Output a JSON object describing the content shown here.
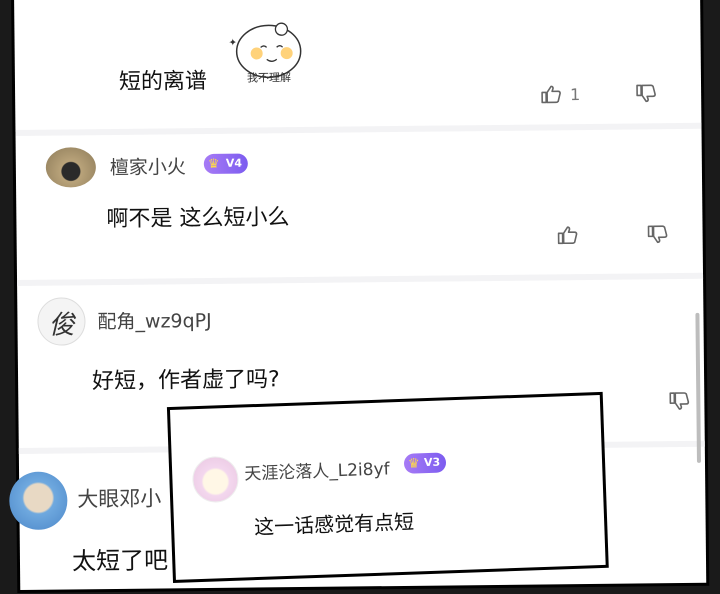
{
  "comments": [
    {
      "content": "短的离谱",
      "like_count": "1",
      "sticker_text": "我不理解"
    },
    {
      "username": "檀家小火",
      "badge": "V4",
      "content": "啊不是 这么短小么"
    },
    {
      "username": "配角_wz9qPJ",
      "avatar_text": "俊",
      "content": "好短，作者虚了吗?"
    },
    {
      "username": "大眼邓小",
      "content": "太短了吧"
    }
  ],
  "overlay_comment": {
    "username": "天涯沦落人_L2i8yf",
    "badge": "V3",
    "content": "这一话感觉有点短"
  },
  "icons": {
    "like": "thumbs-up-icon",
    "dislike": "thumbs-down-icon"
  },
  "colors": {
    "badge": "#8b65f2",
    "text": "#111111",
    "muted": "#777777"
  }
}
